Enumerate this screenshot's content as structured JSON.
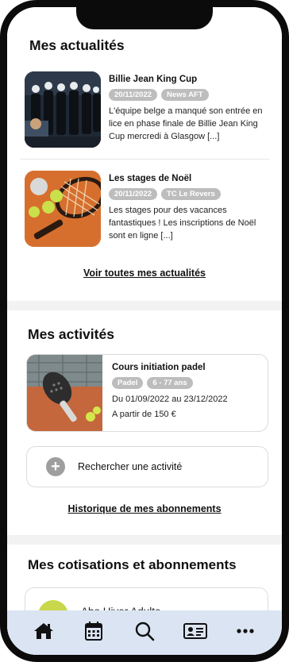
{
  "news": {
    "title": "Mes actualités",
    "items": [
      {
        "title": "Billie Jean King Cup",
        "tags": [
          "20/11/2022",
          "News AFT"
        ],
        "desc": "L'équipe belge a manqué son entrée en lice en phase finale de Billie Jean King Cup mercredi à Glasgow [...]",
        "image": "team-photo"
      },
      {
        "title": "Les stages de Noël",
        "tags": [
          "20/11/2022",
          "TC Le Revers"
        ],
        "desc": "Les stages pour des vacances fantastiques ! Les inscriptions de Noël sont en ligne [...]",
        "image": "tennis-rackets-photo"
      }
    ],
    "see_all": "Voir toutes mes actualités"
  },
  "activities": {
    "title": "Mes activités",
    "card": {
      "title": "Cours initiation padel",
      "tags": [
        "Padel",
        "6 - 77 ans"
      ],
      "dates": "Du 01/09/2022 au 23/12/2022",
      "price": "A partir de 150 €",
      "image": "padel-racket-photo"
    },
    "search_label": "Rechercher une activité",
    "history_link": "Historique de mes abonnements"
  },
  "subscriptions": {
    "title": "Mes cotisations et abonnements",
    "first_item": "Abo Hiver Adulte"
  },
  "nav": {
    "items": [
      "home-icon",
      "calendar-icon",
      "search-icon",
      "member-card-icon",
      "more-icon"
    ]
  },
  "colors": {
    "tag": "#bdbdbd",
    "nav_bg": "#dbe4f3",
    "sub_dot": "#c8d84a"
  }
}
